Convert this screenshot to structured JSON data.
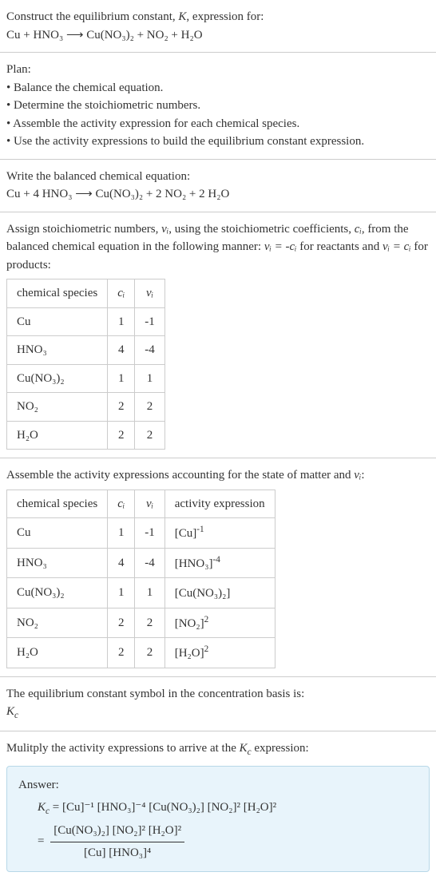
{
  "intro": {
    "line1_pre": "Construct the equilibrium constant, ",
    "line1_K": "K",
    "line1_post": ", expression for:",
    "equation": "Cu + HNO₃ ⟶ Cu(NO₃)₂ + NO₂ + H₂O"
  },
  "plan": {
    "heading": "Plan:",
    "bullet1": "• Balance the chemical equation.",
    "bullet2": "• Determine the stoichiometric numbers.",
    "bullet3": "• Assemble the activity expression for each chemical species.",
    "bullet4": "• Use the activity expressions to build the equilibrium constant expression."
  },
  "balanced": {
    "heading": "Write the balanced chemical equation:",
    "equation": "Cu + 4 HNO₃ ⟶ Cu(NO₃)₂ + 2 NO₂ + 2 H₂O"
  },
  "stoich": {
    "text_pre": "Assign stoichiometric numbers, ",
    "nu_i": "νᵢ",
    "text_mid1": ", using the stoichiometric coefficients, ",
    "c_i": "cᵢ",
    "text_mid2": ", from the balanced chemical equation in the following manner: ",
    "eq_react": "νᵢ = -cᵢ",
    "text_mid3": " for reactants and ",
    "eq_prod": "νᵢ = cᵢ",
    "text_post": " for products:",
    "headers": {
      "species": "chemical species",
      "ci": "cᵢ",
      "nui": "νᵢ"
    },
    "rows": [
      {
        "species": "Cu",
        "ci": "1",
        "nui": "-1"
      },
      {
        "species": "HNO₃",
        "ci": "4",
        "nui": "-4"
      },
      {
        "species": "Cu(NO₃)₂",
        "ci": "1",
        "nui": "1"
      },
      {
        "species": "NO₂",
        "ci": "2",
        "nui": "2"
      },
      {
        "species": "H₂O",
        "ci": "2",
        "nui": "2"
      }
    ]
  },
  "activity": {
    "text_pre": "Assemble the activity expressions accounting for the state of matter and ",
    "nu_i": "νᵢ",
    "text_post": ":",
    "headers": {
      "species": "chemical species",
      "ci": "cᵢ",
      "nui": "νᵢ",
      "expr": "activity expression"
    },
    "rows": [
      {
        "species": "Cu",
        "ci": "1",
        "nui": "-1",
        "expr_base": "[Cu]",
        "expr_exp": "-1"
      },
      {
        "species": "HNO₃",
        "ci": "4",
        "nui": "-4",
        "expr_base": "[HNO₃]",
        "expr_exp": "-4"
      },
      {
        "species": "Cu(NO₃)₂",
        "ci": "1",
        "nui": "1",
        "expr_base": "[Cu(NO₃)₂]",
        "expr_exp": ""
      },
      {
        "species": "NO₂",
        "ci": "2",
        "nui": "2",
        "expr_base": "[NO₂]",
        "expr_exp": "2"
      },
      {
        "species": "H₂O",
        "ci": "2",
        "nui": "2",
        "expr_base": "[H₂O]",
        "expr_exp": "2"
      }
    ]
  },
  "symbol": {
    "text": "The equilibrium constant symbol in the concentration basis is:",
    "kc": "K",
    "kc_sub": "c"
  },
  "multiply": {
    "text_pre": "Mulitply the activity expressions to arrive at the ",
    "kc": "K",
    "kc_sub": "c",
    "text_post": " expression:"
  },
  "answer": {
    "label": "Answer:",
    "kc": "K",
    "kc_sub": "c",
    "line1": " = [Cu]⁻¹ [HNO₃]⁻⁴ [Cu(NO₃)₂] [NO₂]² [H₂O]²",
    "eq": "= ",
    "numerator": "[Cu(NO₃)₂] [NO₂]² [H₂O]²",
    "denominator": "[Cu] [HNO₃]⁴"
  }
}
